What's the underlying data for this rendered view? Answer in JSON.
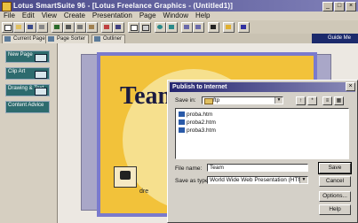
{
  "window": {
    "title": "Lotus SmartSuite 96 - [Lotus Freelance Graphics - (Untitled1)]",
    "controls": [
      "_",
      "□",
      "×"
    ]
  },
  "menu": [
    "File",
    "Edit",
    "View",
    "Create",
    "Presentation",
    "Page",
    "Window",
    "Help"
  ],
  "tabs": {
    "current_page": "Current Page",
    "page_sorter": "Page Sorter",
    "outliner": "Outliner"
  },
  "guide_label": "Guide Me",
  "left_panel": {
    "buttons": [
      "New Page",
      "Clip Art",
      "Drawing & Text",
      "Content Advice"
    ]
  },
  "slide": {
    "title_text": "Team",
    "bottom_text": "dre"
  },
  "dialog": {
    "title": "Publish to Internet",
    "close": "×",
    "save_in_label": "Save in:",
    "save_in_value": "ftp",
    "files": [
      "proba.htm",
      "proba2.htm",
      "proba3.htm"
    ],
    "file_name_label": "File name:",
    "file_name_value": "Team",
    "save_as_type_label": "Save as type:",
    "save_as_type_value": "World Wide Web Presentation (HTM)",
    "buttons": {
      "save": "Save",
      "cancel": "Cancel",
      "options": "Options...",
      "help": "Help"
    }
  },
  "colors": {
    "titlebar": "#4a4a8a",
    "dialog_title": "#25256f",
    "slide_background": "#f2c23a",
    "left_panel_button": "#2d6b6e"
  }
}
